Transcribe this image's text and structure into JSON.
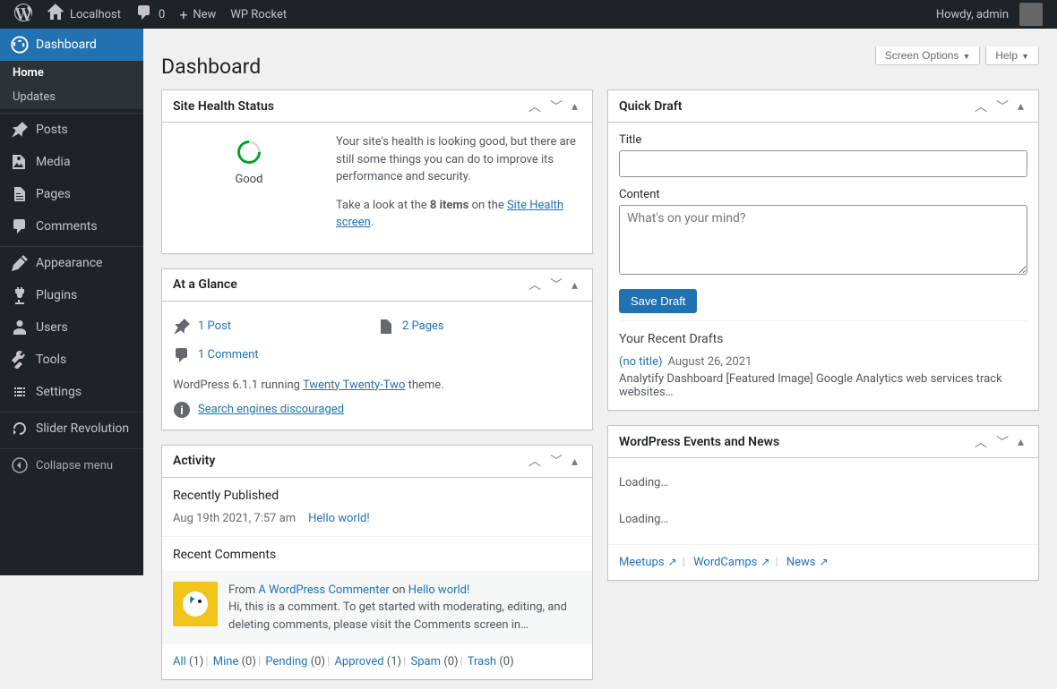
{
  "adminbar": {
    "site_name": "Localhost",
    "comments_count": "0",
    "new_label": "New",
    "wprocket_label": "WP Rocket",
    "howdy": "Howdy, admin"
  },
  "menu": {
    "dashboard": "Dashboard",
    "home": "Home",
    "updates": "Updates",
    "posts": "Posts",
    "media": "Media",
    "pages": "Pages",
    "comments": "Comments",
    "appearance": "Appearance",
    "plugins": "Plugins",
    "users": "Users",
    "tools": "Tools",
    "settings": "Settings",
    "slider": "Slider Revolution",
    "collapse": "Collapse menu"
  },
  "page_title": "Dashboard",
  "screen_options": "Screen Options",
  "help_label": "Help",
  "health": {
    "title": "Site Health Status",
    "status": "Good",
    "msg": "Your site's health is looking good, but there are still some things you can do to improve its performance and security.",
    "link_prefix": "Take a look at the ",
    "items_bold": "8 items",
    "link_mid": " on the ",
    "link_text": "Site Health screen",
    "period": "."
  },
  "glance": {
    "title": "At a Glance",
    "posts": "1 Post",
    "pages": "2 Pages",
    "comments": "1 Comment",
    "version_pre": "WordPress 6.1.1 running ",
    "theme": "Twenty Twenty-Two",
    "version_post": " theme.",
    "discouraged": "Search engines discouraged"
  },
  "activity": {
    "title": "Activity",
    "recently_published": "Recently Published",
    "pub_date": "Aug 19th 2021, 7:57 am",
    "pub_title": "Hello world!",
    "recent_comments": "Recent Comments",
    "comment_from": "From ",
    "comment_author": "A WordPress Commenter",
    "comment_on": " on ",
    "comment_post": "Hello world!",
    "comment_text": "Hi, this is a comment. To get started with moderating, editing, and deleting comments, please visit the Comments screen in…",
    "filters": {
      "all": "All",
      "all_c": "(1)",
      "mine": "Mine",
      "mine_c": "(0)",
      "pending": "Pending",
      "pending_c": "(0)",
      "approved": "Approved",
      "approved_c": "(1)",
      "spam": "Spam",
      "spam_c": "(0)",
      "trash": "Trash",
      "trash_c": "(0)"
    }
  },
  "quickdraft": {
    "title": "Quick Draft",
    "title_label": "Title",
    "content_label": "Content",
    "content_placeholder": "What's on your mind?",
    "save": "Save Draft",
    "recent_drafts": "Your Recent Drafts",
    "draft_title": "(no title)",
    "draft_date": "August 26, 2021",
    "draft_excerpt": "Analytify Dashboard [Featured Image] Google Analytics web services track websites…"
  },
  "events": {
    "title": "WordPress Events and News",
    "loading": "Loading…",
    "meetups": "Meetups",
    "wordcamps": "WordCamps",
    "news": "News"
  }
}
